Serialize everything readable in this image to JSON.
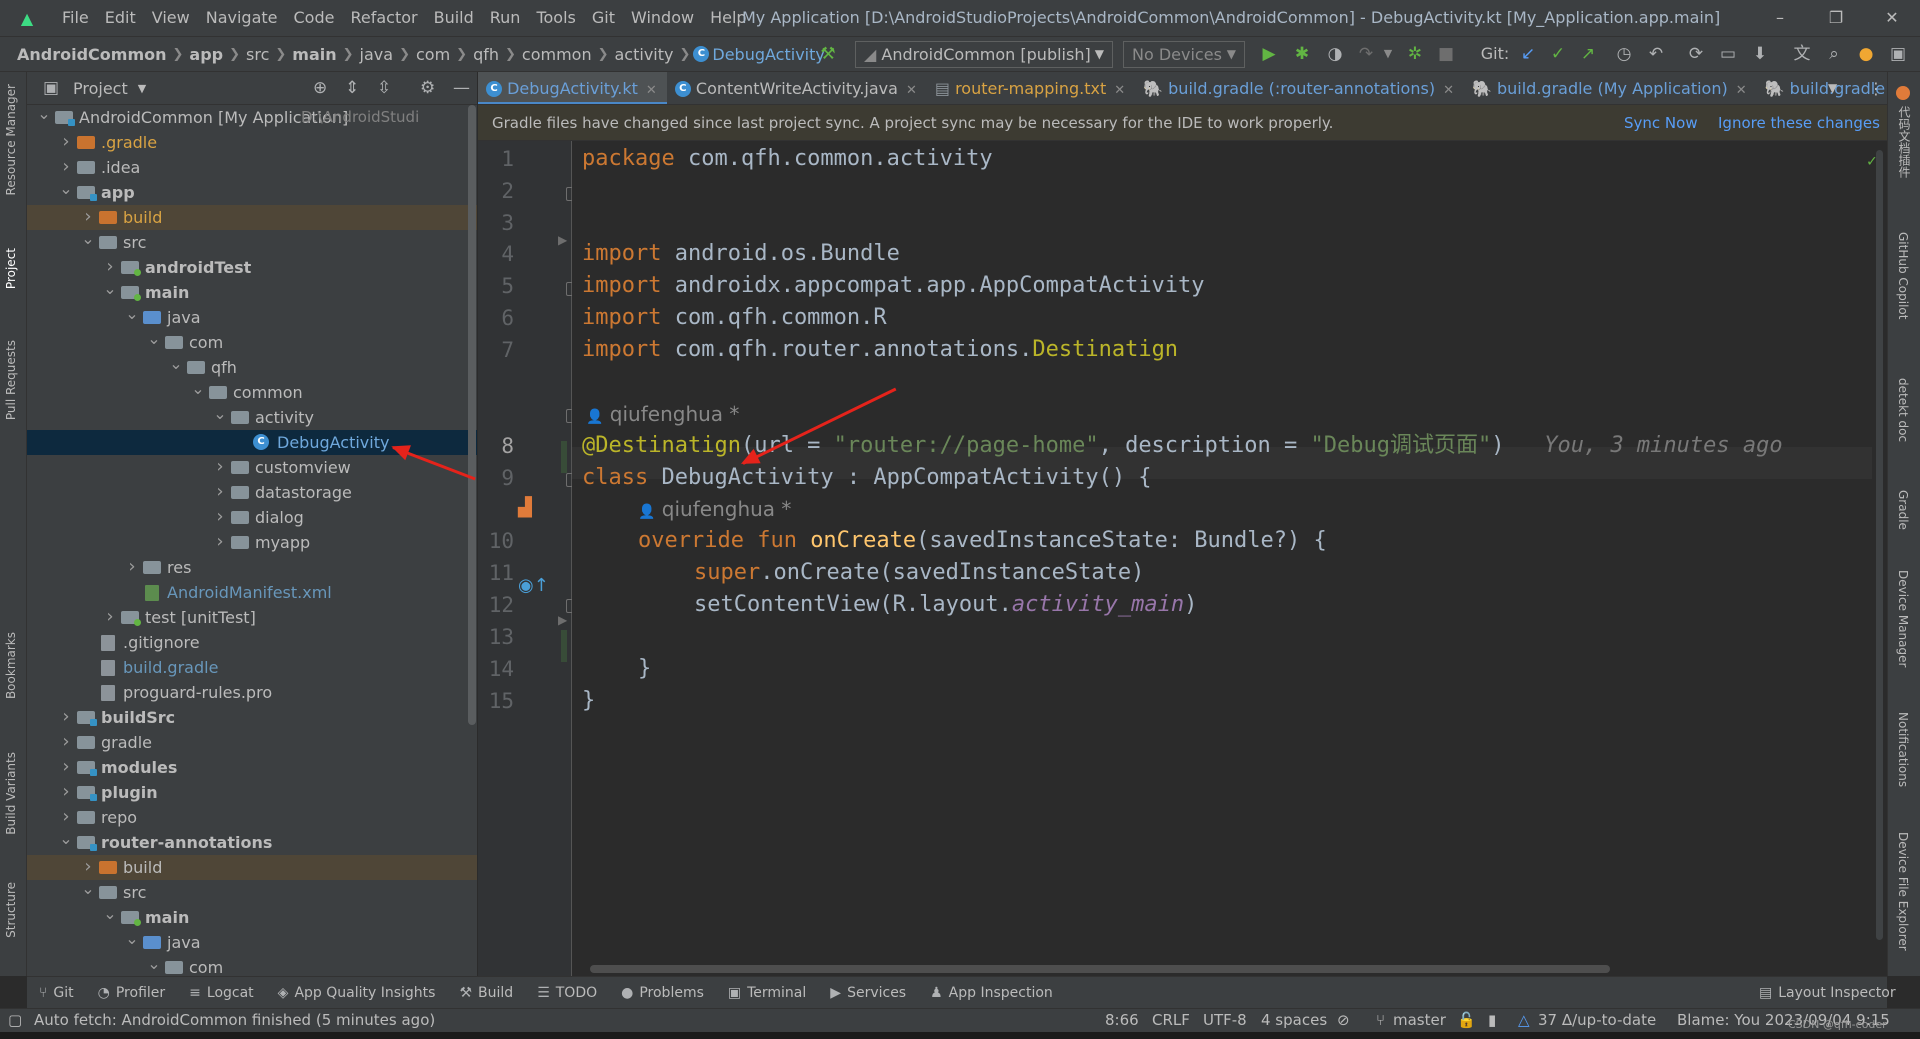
{
  "menubar": {
    "items": [
      "File",
      "Edit",
      "View",
      "Navigate",
      "Code",
      "Refactor",
      "Build",
      "Run",
      "Tools",
      "Git",
      "Window",
      "Help"
    ],
    "window_title": "My Application [D:\\AndroidStudioProjects\\AndroidCommon\\AndroidCommon] - DebugActivity.kt [My_Application.app.main]",
    "minimize": "–",
    "maximize": "❐",
    "close": "✕"
  },
  "navbar": {
    "breadcrumbs": [
      "AndroidCommon",
      "app",
      "src",
      "main",
      "java",
      "com",
      "qfh",
      "common",
      "activity",
      "DebugActivity"
    ],
    "run_config": "AndroidCommon [publish]",
    "device": "No Devices",
    "git_label": "Git:"
  },
  "sidebar_left": {
    "tabs": [
      "Resource Manager",
      "Project",
      "Pull Requests",
      "Bookmarks",
      "Build Variants",
      "Structure"
    ]
  },
  "sidebar_right": {
    "tabs": [
      "代码文档插件",
      "GitHub Copilot",
      "detekt doc",
      "Gradle",
      "Device Manager",
      "Notifications",
      "Device File Explorer"
    ]
  },
  "project_panel": {
    "title": "Project",
    "tree": [
      {
        "text": "AndroidCommon [My Application]",
        "hint": "D:\\AndroidStudi",
        "depth": 0,
        "open": true,
        "icon": "mod",
        "bold": false
      },
      {
        "text": ".gradle",
        "depth": 1,
        "open": false,
        "icon": "orange",
        "color": "orange"
      },
      {
        "text": ".idea",
        "depth": 1,
        "open": false,
        "icon": "folder"
      },
      {
        "text": "app",
        "depth": 1,
        "open": true,
        "icon": "mod",
        "bold": true
      },
      {
        "text": "build",
        "depth": 2,
        "open": false,
        "icon": "orange",
        "color": "orange",
        "hl": true
      },
      {
        "text": "src",
        "depth": 2,
        "open": true,
        "icon": "folder"
      },
      {
        "text": "androidTest",
        "depth": 3,
        "open": false,
        "icon": "src",
        "bold": true
      },
      {
        "text": "main",
        "depth": 3,
        "open": true,
        "icon": "src",
        "bold": true
      },
      {
        "text": "java",
        "depth": 4,
        "open": true,
        "icon": "blue"
      },
      {
        "text": "com",
        "depth": 5,
        "open": true,
        "icon": "folder"
      },
      {
        "text": "qfh",
        "depth": 6,
        "open": true,
        "icon": "folder"
      },
      {
        "text": "common",
        "depth": 7,
        "open": true,
        "icon": "folder"
      },
      {
        "text": "activity",
        "depth": 8,
        "open": true,
        "icon": "folder"
      },
      {
        "text": "DebugActivity",
        "depth": 9,
        "leaf": true,
        "icon": "kt",
        "color": "blue",
        "sel": true
      },
      {
        "text": "customview",
        "depth": 8,
        "open": false,
        "icon": "folder"
      },
      {
        "text": "datastorage",
        "depth": 8,
        "open": false,
        "icon": "folder"
      },
      {
        "text": "dialog",
        "depth": 8,
        "open": false,
        "icon": "folder"
      },
      {
        "text": "myapp",
        "depth": 8,
        "open": false,
        "icon": "folder"
      },
      {
        "text": "res",
        "depth": 4,
        "open": false,
        "icon": "folder"
      },
      {
        "text": "AndroidManifest.xml",
        "depth": 4,
        "leaf": true,
        "icon": "file-green",
        "color": "blue"
      },
      {
        "text": "test [unitTest]",
        "depth": 3,
        "open": false,
        "icon": "src",
        "boldpart": "[unitTest]"
      },
      {
        "text": ".gitignore",
        "depth": 2,
        "leaf": true,
        "icon": "file"
      },
      {
        "text": "build.gradle",
        "depth": 2,
        "leaf": true,
        "icon": "file",
        "color": "blue"
      },
      {
        "text": "proguard-rules.pro",
        "depth": 2,
        "leaf": true,
        "icon": "file"
      },
      {
        "text": "buildSrc",
        "depth": 1,
        "open": false,
        "icon": "mod",
        "bold": true
      },
      {
        "text": "gradle",
        "depth": 1,
        "open": false,
        "icon": "folder"
      },
      {
        "text": "modules",
        "depth": 1,
        "open": false,
        "icon": "mod",
        "bold": true
      },
      {
        "text": "plugin",
        "depth": 1,
        "open": false,
        "icon": "mod",
        "bold": true
      },
      {
        "text": "repo",
        "depth": 1,
        "open": false,
        "icon": "folder"
      },
      {
        "text": "router-annotations",
        "depth": 1,
        "open": true,
        "icon": "mod",
        "bold": true
      },
      {
        "text": "build",
        "depth": 2,
        "open": false,
        "icon": "orange",
        "hl": true
      },
      {
        "text": "src",
        "depth": 2,
        "open": true,
        "icon": "folder"
      },
      {
        "text": "main",
        "depth": 3,
        "open": true,
        "icon": "src",
        "bold": true
      },
      {
        "text": "java",
        "depth": 4,
        "open": true,
        "icon": "blue"
      },
      {
        "text": "com",
        "depth": 5,
        "open": true,
        "icon": "folder"
      }
    ]
  },
  "editor_tabs": [
    {
      "label": "DebugActivity.kt",
      "active": true,
      "kind": "kt"
    },
    {
      "label": "ContentWriteActivity.java",
      "kind": "java"
    },
    {
      "label": "router-mapping.txt",
      "kind": "txt"
    },
    {
      "label": "build.gradle (:router-annotations)",
      "kind": "gradle"
    },
    {
      "label": "build.gradle (My Application)",
      "kind": "gradle"
    },
    {
      "label": "build.gradle",
      "kind": "gradle"
    }
  ],
  "banner": {
    "message": "Gradle files have changed since last project sync. A project sync may be necessary for the IDE to work properly.",
    "sync": "Sync Now",
    "ignore": "Ignore these changes"
  },
  "code": {
    "line_numbers": [
      "1",
      "2",
      "3",
      "4",
      "5",
      "6",
      "7",
      "8",
      "9",
      "10",
      "11",
      "12",
      "13",
      "14",
      "15"
    ],
    "package_kw": "package",
    "package_name": "com.qfh.common.activity",
    "import_kw": "import",
    "imports": [
      "android.os.Bundle",
      "androidx.appcompat.app.AppCompatActivity",
      "com.qfh.common.R"
    ],
    "import4_prefix": "com.qfh.router.annotations.",
    "import4_class": "Destinatign",
    "author": "qiufenghua *",
    "annotation": "@Destinatign",
    "ann_args_1": "(url = ",
    "ann_url": "\"router://page-home\"",
    "ann_args_2": ", description = ",
    "ann_desc": "\"Debug调试页面\"",
    "ann_close": ")",
    "blame": "You, 3 minutes ago",
    "class_kw": "class",
    "class_sig": " DebugActivity : AppCompatActivity() {",
    "override_kw": "override fun ",
    "fn_name": "onCreate",
    "fn_sig": "(savedInstanceState: Bundle?) {",
    "super_kw": "super",
    "super_call": ".onCreate(savedInstanceState)",
    "set_content": "setContentView(R.layout.",
    "layout_name": "activity_main",
    "close_paren": ")",
    "close_brace_inner": "}",
    "close_brace_outer": "}"
  },
  "toolwindows": [
    {
      "icon": "⑂",
      "label": "Git"
    },
    {
      "icon": "◔",
      "label": "Profiler"
    },
    {
      "icon": "≡",
      "label": "Logcat"
    },
    {
      "icon": "◈",
      "label": "App Quality Insights"
    },
    {
      "icon": "⚒",
      "label": "Build"
    },
    {
      "icon": "☰",
      "label": "TODO"
    },
    {
      "icon": "●",
      "label": "Problems"
    },
    {
      "icon": "▣",
      "label": "Terminal"
    },
    {
      "icon": "▶",
      "label": "Services"
    },
    {
      "icon": "♟",
      "label": "App Inspection"
    }
  ],
  "layout_inspector": "Layout Inspector",
  "status": {
    "message": "Auto fetch: AndroidCommon finished (5 minutes ago)",
    "position": "8:66",
    "line_sep": "CRLF",
    "encoding": "UTF-8",
    "indent": "4 spaces",
    "branch": "master",
    "updates": "37 Δ/up-to-date",
    "blame": "Blame: You 2023/09/04 9:15",
    "watermark": "CSDN @qfh-coder"
  },
  "colors": {
    "keyword": "#cc7832",
    "annotation": "#bbb529",
    "string": "#6a8759",
    "function": "#ffc66d",
    "field": "#9876aa",
    "arrow": "#e5231b"
  }
}
